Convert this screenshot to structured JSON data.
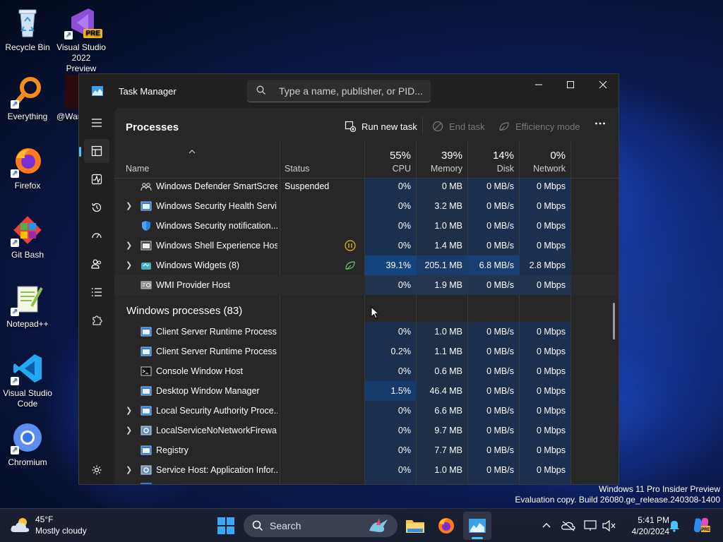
{
  "desktop": {
    "icons": [
      {
        "label": "Recycle Bin"
      },
      {
        "label": "Visual Studio 2022 Preview",
        "badge": "PRE"
      },
      {
        "label": "Everything"
      },
      {
        "label": "@War"
      },
      {
        "label": "Firefox"
      },
      {
        "label": "Git Bash"
      },
      {
        "label": "Notepad++"
      },
      {
        "label": "Visual Studio Code"
      },
      {
        "label": "Chromium"
      }
    ]
  },
  "task_manager": {
    "title": "Task Manager",
    "search_placeholder": "Type a name, publisher, or PID...",
    "page_title": "Processes",
    "commands": {
      "run_new_task": "Run new task",
      "end_task": "End task",
      "efficiency_mode": "Efficiency mode"
    },
    "columns": {
      "name": "Name",
      "status": "Status",
      "cpu": {
        "pct": "55%",
        "label": "CPU"
      },
      "memory": {
        "pct": "39%",
        "label": "Memory"
      },
      "disk": {
        "pct": "14%",
        "label": "Disk"
      },
      "network": {
        "pct": "0%",
        "label": "Network"
      }
    },
    "rows": [
      {
        "name": "Windows Defender SmartScreen",
        "status": "Suspended",
        "cpu": "0%",
        "memory": "0 MB",
        "disk": "0 MB/s",
        "network": "0 Mbps",
        "expandable": false,
        "icon": "people-icon"
      },
      {
        "name": "Windows Security Health Servi...",
        "status": "",
        "cpu": "0%",
        "memory": "3.2 MB",
        "disk": "0 MB/s",
        "network": "0 Mbps",
        "expandable": true,
        "icon": "window-app-icon"
      },
      {
        "name": "Windows Security notification...",
        "status": "",
        "cpu": "0%",
        "memory": "1.0 MB",
        "disk": "0 MB/s",
        "network": "0 Mbps",
        "expandable": false,
        "icon": "shield-icon"
      },
      {
        "name": "Windows Shell Experience Hos...",
        "status": "",
        "cpu": "0%",
        "memory": "1.4 MB",
        "disk": "0 MB/s",
        "network": "0 Mbps",
        "expandable": true,
        "icon": "window-app-icon",
        "status_icon": "paused-icon"
      },
      {
        "name": "Windows Widgets (8)",
        "status": "",
        "cpu": "39.1%",
        "memory": "205.1 MB",
        "disk": "6.8 MB/s",
        "network": "2.8 Mbps",
        "expandable": true,
        "icon": "widgets-icon",
        "status_icon": "efficiency-leaf-icon"
      },
      {
        "name": "WMI Provider Host",
        "status": "",
        "cpu": "0%",
        "memory": "1.9 MB",
        "disk": "0 MB/s",
        "network": "0 Mbps",
        "expandable": false,
        "icon": "wmi-icon"
      }
    ],
    "group": {
      "title": "Windows processes (83)"
    },
    "group_rows": [
      {
        "name": "Client Server Runtime Process",
        "cpu": "0%",
        "memory": "1.0 MB",
        "disk": "0 MB/s",
        "network": "0 Mbps",
        "expandable": false,
        "icon": "window-app-icon"
      },
      {
        "name": "Client Server Runtime Process",
        "cpu": "0.2%",
        "memory": "1.1 MB",
        "disk": "0 MB/s",
        "network": "0 Mbps",
        "expandable": false,
        "icon": "window-app-icon"
      },
      {
        "name": "Console Window Host",
        "cpu": "0%",
        "memory": "0.6 MB",
        "disk": "0 MB/s",
        "network": "0 Mbps",
        "expandable": false,
        "icon": "console-icon"
      },
      {
        "name": "Desktop Window Manager",
        "cpu": "1.5%",
        "memory": "46.4 MB",
        "disk": "0 MB/s",
        "network": "0 Mbps",
        "expandable": false,
        "icon": "window-app-icon"
      },
      {
        "name": "Local Security Authority Proce...",
        "cpu": "0%",
        "memory": "6.6 MB",
        "disk": "0 MB/s",
        "network": "0 Mbps",
        "expandable": true,
        "icon": "window-app-icon"
      },
      {
        "name": "LocalServiceNoNetworkFirewa...",
        "cpu": "0%",
        "memory": "9.7 MB",
        "disk": "0 MB/s",
        "network": "0 Mbps",
        "expandable": true,
        "icon": "gear-service-icon"
      },
      {
        "name": "Registry",
        "cpu": "0%",
        "memory": "7.7 MB",
        "disk": "0 MB/s",
        "network": "0 Mbps",
        "expandable": false,
        "icon": "window-app-icon"
      },
      {
        "name": "Service Host: Application Infor...",
        "cpu": "0%",
        "memory": "1.0 MB",
        "disk": "0 MB/s",
        "network": "0 Mbps",
        "expandable": true,
        "icon": "gear-service-icon"
      }
    ]
  },
  "watermark": {
    "line1": "Windows 11 Pro Insider Preview",
    "line2": "Evaluation copy. Build 26080.ge_release.240308-1400"
  },
  "taskbar": {
    "weather_temp": "45°F",
    "weather_condition": "Mostly cloudy",
    "search_label": "Search",
    "time": "5:41 PM",
    "date": "4/20/2024"
  }
}
